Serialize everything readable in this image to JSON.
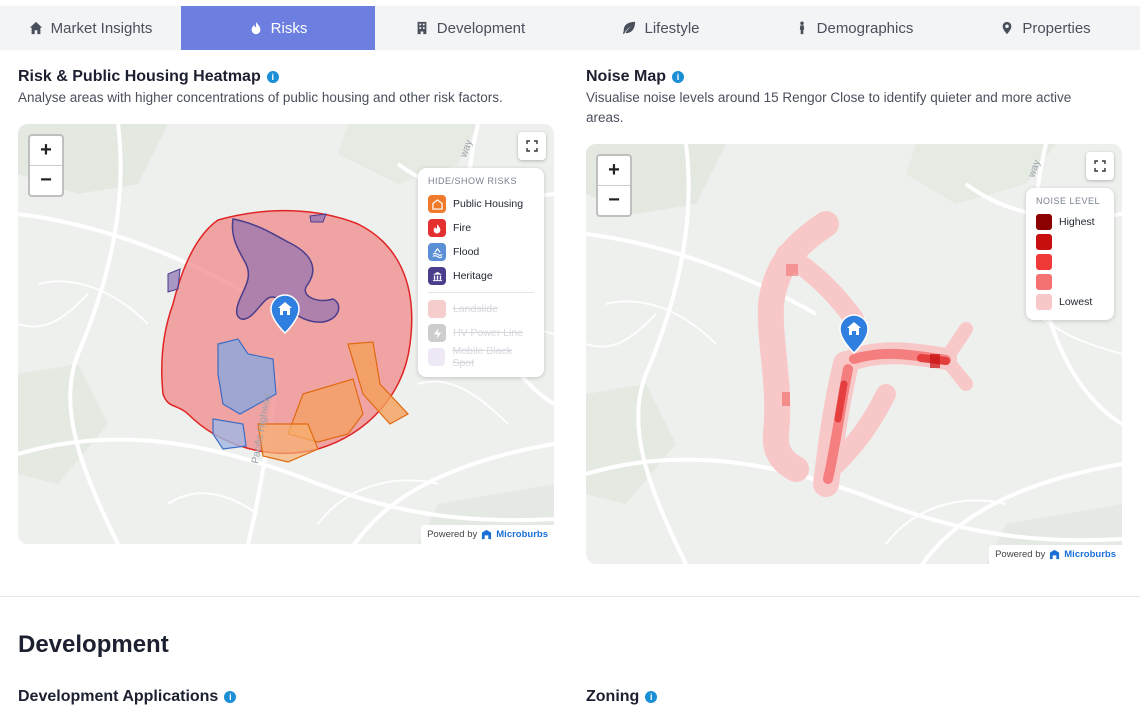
{
  "tabs": [
    {
      "label": "Market Insights",
      "icon": "home-icon",
      "active": false
    },
    {
      "label": "Risks",
      "icon": "flame-icon",
      "active": true
    },
    {
      "label": "Development",
      "icon": "building-icon",
      "active": false
    },
    {
      "label": "Lifestyle",
      "icon": "leaf-icon",
      "active": false
    },
    {
      "label": "Demographics",
      "icon": "person-icon",
      "active": false
    },
    {
      "label": "Properties",
      "icon": "map-pin-icon",
      "active": false
    }
  ],
  "risk_map": {
    "title": "Risk & Public Housing Heatmap",
    "subtitle": "Analyse areas with higher concentrations of public housing and other risk factors.",
    "zoom_in": "+",
    "zoom_out": "−",
    "legend_title": "HIDE/SHOW RISKS",
    "legend": [
      {
        "label": "Public Housing",
        "color": "#f07a2b",
        "enabled": true
      },
      {
        "label": "Fire",
        "color": "#e53030",
        "enabled": true
      },
      {
        "label": "Flood",
        "color": "#5b8fd6",
        "enabled": true
      },
      {
        "label": "Heritage",
        "color": "#4a3d8c",
        "enabled": true
      },
      {
        "label": "Landslide",
        "color": "#f2b8b8",
        "enabled": false
      },
      {
        "label": "HV Power Line",
        "color": "#b8b8b8",
        "enabled": false
      },
      {
        "label": "Mobile Black Spot",
        "color": "#e8e0f0",
        "enabled": false
      }
    ],
    "street_label": "Pacific Highway",
    "road_label": "way",
    "powered_by": "Powered by",
    "brand": "Microburbs"
  },
  "noise_map": {
    "title": "Noise Map",
    "subtitle": "Visualise noise levels around 15 Rengor Close to identify quieter and more active areas.",
    "zoom_in": "+",
    "zoom_out": "−",
    "legend_title": "NOISE LEVEL",
    "levels": [
      {
        "label": "Highest",
        "color": "#8b0000"
      },
      {
        "label": "",
        "color": "#c80f0f"
      },
      {
        "label": "",
        "color": "#f03a3a"
      },
      {
        "label": "",
        "color": "#f47272"
      },
      {
        "label": "Lowest",
        "color": "#f8c8c8"
      }
    ],
    "road_label": "way",
    "powered_by": "Powered by",
    "brand": "Microburbs"
  },
  "development": {
    "heading": "Development",
    "sub_left": "Development Applications",
    "sub_right": "Zoning"
  }
}
